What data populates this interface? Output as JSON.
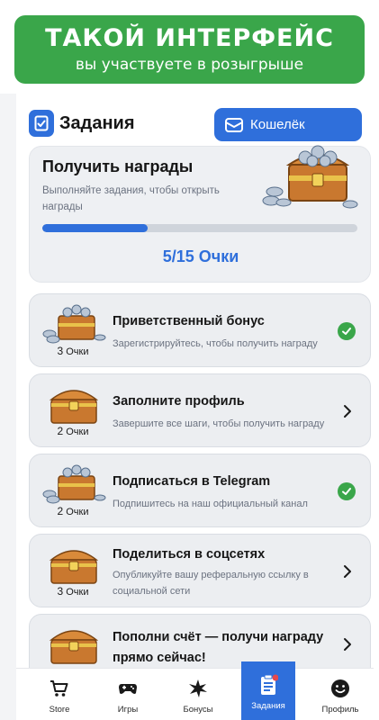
{
  "banner": {
    "title": "ТАКОЙ ИНТЕРФЕЙС",
    "subtitle": "вы участвуете в розыгрыше"
  },
  "header": {
    "title": "Задания",
    "wallet_label": "Кошелёк"
  },
  "rewards": {
    "title": "Получить награды",
    "description": "Выполняйте задания, чтобы открыть награды",
    "progress_fraction": 0.333,
    "points_text": "5/15 Очки"
  },
  "tasks": [
    {
      "title": "Приветственный бонус",
      "subtitle": "Зарегистрируйтесь, чтобы получить награду",
      "points": "3",
      "points_unit": "Очки",
      "status": "completed"
    },
    {
      "title": "Заполните профиль",
      "subtitle": "Завершите все шаги, чтобы получить награду",
      "points": "2",
      "points_unit": "Очки",
      "status": "open"
    },
    {
      "title": "Подписаться в Telegram",
      "subtitle": "Подпишитесь на наш официальный канал",
      "points": "2",
      "points_unit": "Очки",
      "status": "completed"
    },
    {
      "title": "Поделиться в соцсетях",
      "subtitle": "Опубликуйте вашу реферальную ссылку в социальной сети",
      "points": "3",
      "points_unit": "Очки",
      "status": "open"
    },
    {
      "title": "Пополни счёт — получи награду прямо сейчас!",
      "subtitle": "",
      "points": "",
      "points_unit": "",
      "status": "open"
    }
  ],
  "nav": {
    "items": [
      {
        "label": "Store",
        "icon": "cart-icon"
      },
      {
        "label": "Игры",
        "icon": "gamepad-icon"
      },
      {
        "label": "Бонусы",
        "icon": "sparkle-icon"
      },
      {
        "label": "Задания",
        "icon": "clipboard-icon",
        "active": true
      },
      {
        "label": "Профиль",
        "icon": "smile-icon"
      }
    ]
  },
  "colors": {
    "accent": "#2f6fdb",
    "banner_green": "#3aa64a",
    "check_green": "#3aa64a"
  }
}
